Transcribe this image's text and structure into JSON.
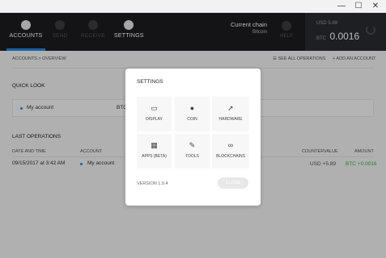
{
  "window": {
    "minimize": "—",
    "maximize": "☐",
    "close": "✕"
  },
  "nav": {
    "accounts": "ACCOUNTS",
    "send": "SEND",
    "receive": "RECEIVE",
    "settings": "SETTINGS",
    "help": "HELP"
  },
  "chain": {
    "label": "Current chain",
    "value": "Bitcoin"
  },
  "balance": {
    "usd": "USD 5.89",
    "btc_unit": "BTC",
    "btc_amount": "0.0016"
  },
  "breadcrumb": "ACCOUNTS  >  OVERVIEW",
  "actions": {
    "see_all": "☰  SEE ALL OPERATIONS",
    "add_account": "+  ADD AN ACCOUNT"
  },
  "quick_look": {
    "title": "QUICK LOOK",
    "account_name": "My account",
    "account_unit": "BTC"
  },
  "last_operations": {
    "title": "LAST OPERATIONS",
    "headers": {
      "date": "DATE AND TIME",
      "account": "ACCOUNT",
      "countervalue": "COUNTERVALUE",
      "amount": "AMOUNT"
    },
    "rows": [
      {
        "date": "09/15/2017 at 3:42 AM",
        "account": "My account",
        "countervalue": "USD +5.89",
        "amount": "BTC +0.0016"
      }
    ]
  },
  "settings_modal": {
    "title": "SETTINGS",
    "tiles": [
      {
        "label": "DISPLAY",
        "icon": "monitor-icon"
      },
      {
        "label": "COIN",
        "icon": "globe-icon"
      },
      {
        "label": "HARDWARE",
        "icon": "rocket-icon"
      },
      {
        "label": "APPS (BETA)",
        "icon": "grid-icon"
      },
      {
        "label": "TOOLS",
        "icon": "wrench-icon"
      },
      {
        "label": "BLOCKCHAINS",
        "icon": "link-icon"
      }
    ],
    "version": "VERSION 1.9.4",
    "close_label": "CLOSE"
  },
  "colors": {
    "accent": "#1e88e5",
    "positive": "#2bb24c",
    "nav_bg": "#1c1d21"
  }
}
